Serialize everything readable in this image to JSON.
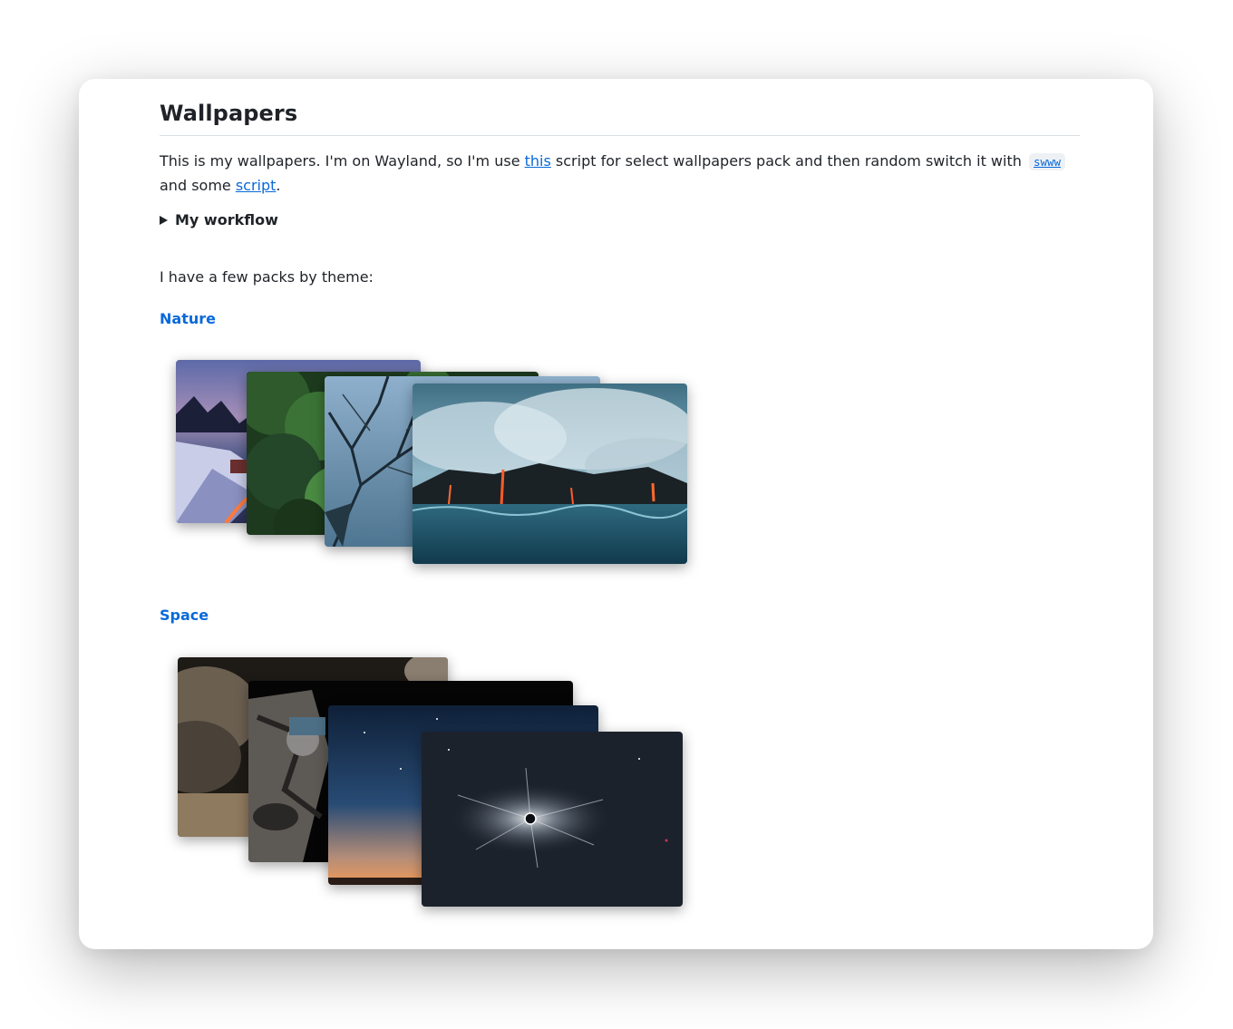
{
  "page": {
    "title": "Wallpapers",
    "intro": {
      "text_1": "This is my wallpapers. I'm on Wayland, so I'm use ",
      "link_this": "this",
      "text_2": " script for select wallpapers pack and then random switch it with ",
      "code_swww": "swww",
      "text_3": " and some ",
      "link_script": "script",
      "text_4": "."
    },
    "details_summary": "My workflow",
    "packs_intro": "I have a few packs by theme:",
    "sections": [
      {
        "name": "Nature"
      },
      {
        "name": "Space"
      }
    ]
  },
  "colors": {
    "link": "#0969da",
    "text": "#1f2328",
    "rule": "#d8dee4",
    "code_bg": "#eef1f4"
  },
  "icons": {
    "details_toggle": "disclosure-triangle-right-icon"
  }
}
